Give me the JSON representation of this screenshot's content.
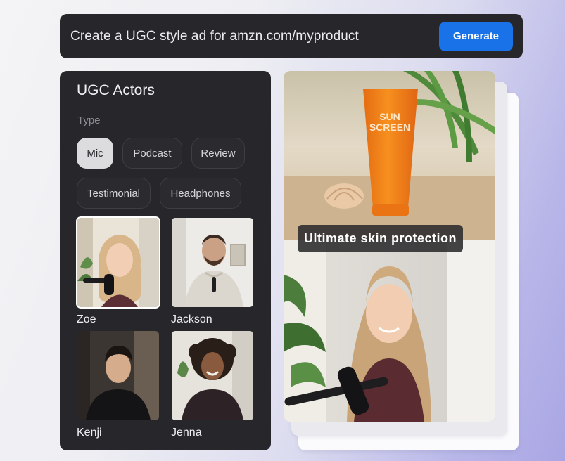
{
  "prompt": {
    "text": "Create a UGC style ad for amzn.com/myproduct",
    "generate_label": "Generate"
  },
  "panel": {
    "title": "UGC Actors",
    "type_label": "Type",
    "chips": [
      {
        "label": "Mic",
        "active": true
      },
      {
        "label": "Podcast",
        "active": false
      },
      {
        "label": "Review",
        "active": false
      },
      {
        "label": "Testimonial",
        "active": false
      },
      {
        "label": "Headphones",
        "active": false
      }
    ],
    "actors": [
      {
        "name": "Zoe",
        "selected": true
      },
      {
        "name": "Jackson",
        "selected": false
      },
      {
        "name": "Kenji",
        "selected": false
      },
      {
        "name": "Jenna",
        "selected": false
      }
    ]
  },
  "preview": {
    "product_line1": "SUN",
    "product_line2": "SCREEN",
    "caption": "Ultimate skin protection"
  },
  "colors": {
    "panel_bg": "#26262b",
    "accent_blue": "#1a72e8",
    "product_orange": "#f5831f"
  }
}
